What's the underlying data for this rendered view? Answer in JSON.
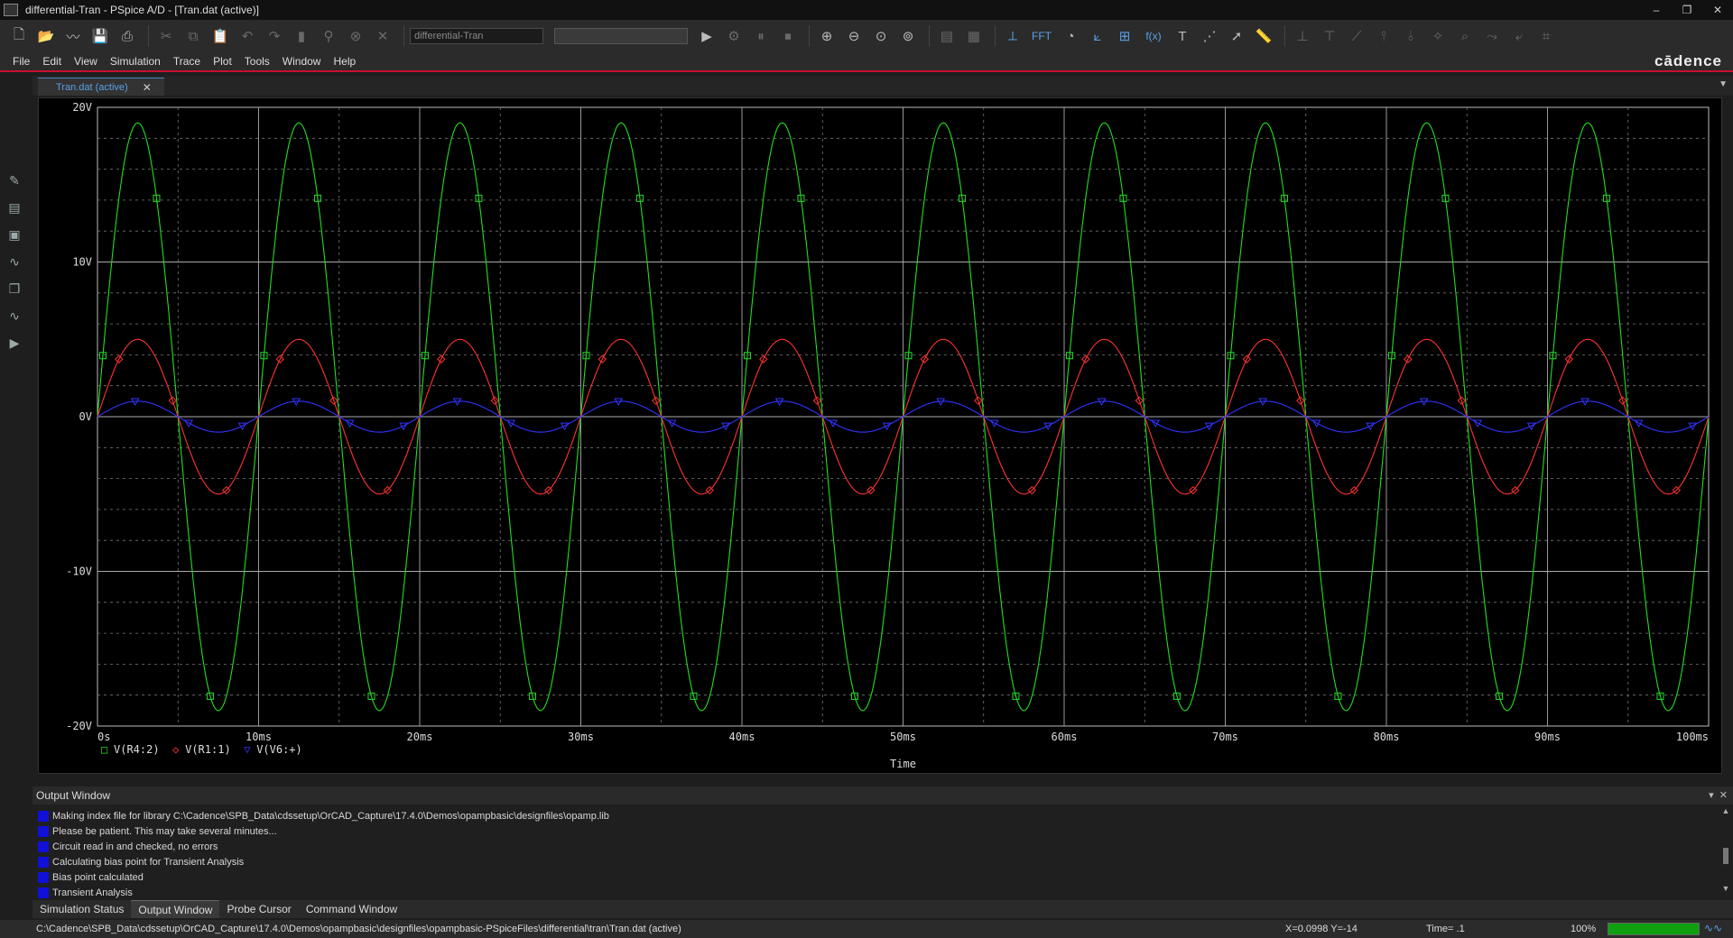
{
  "window": {
    "title": "differential-Tran - PSpice A/D  - [Tran.dat (active)]",
    "controls": [
      "–",
      "❐",
      "✕"
    ]
  },
  "toolbar": {
    "profile_value": "differential-Tran",
    "fft_label": "FFT",
    "fx_label": "f(x)"
  },
  "menu": [
    "File",
    "Edit",
    "View",
    "Simulation",
    "Trace",
    "Plot",
    "Tools",
    "Window",
    "Help"
  ],
  "brand": "cādence",
  "document_tab": {
    "label": "Tran.dat (active)",
    "close": "✕"
  },
  "plot": {
    "x_axis_title": "Time",
    "x_ticks": [
      "0s",
      "10ms",
      "20ms",
      "30ms",
      "40ms",
      "50ms",
      "60ms",
      "70ms",
      "80ms",
      "90ms",
      "100ms"
    ],
    "y_ticks": [
      "20V",
      "10V",
      "0V",
      "-10V",
      "-20V"
    ],
    "legend": [
      {
        "marker": "□",
        "name": "V(R4:2)",
        "color": "#22dd22"
      },
      {
        "marker": "◇",
        "name": "V(R1:1)",
        "color": "#ff3333"
      },
      {
        "marker": "▽",
        "name": "V(V6:+)",
        "color": "#3333ff"
      }
    ]
  },
  "chart_data": {
    "type": "line",
    "title": "",
    "xlabel": "Time",
    "ylabel": "",
    "xlim": [
      0,
      0.1
    ],
    "ylim": [
      -20,
      20
    ],
    "x_unit": "s",
    "y_unit": "V",
    "grid": true,
    "legend_position": "bottom-left",
    "series": [
      {
        "name": "V(R4:2)",
        "shape": "sine",
        "amplitude": 19,
        "frequency_hz": 100,
        "color": "#22dd22",
        "marker": "square"
      },
      {
        "name": "V(R1:1)",
        "shape": "sine",
        "amplitude": 5,
        "frequency_hz": 100,
        "color": "#ff3333",
        "marker": "diamond"
      },
      {
        "name": "V(V6:+)",
        "shape": "sine",
        "amplitude": 1,
        "frequency_hz": 100,
        "color": "#3333ff",
        "marker": "triangle-down"
      }
    ]
  },
  "output_window": {
    "title": "Output Window",
    "messages": [
      "Making index file for library C:\\Cadence\\SPB_Data\\cdssetup\\OrCAD_Capture\\17.4.0\\Demos\\opampbasic\\designfiles\\opamp.lib",
      "Please be patient. This may take several minutes...",
      "Circuit read in and checked, no errors",
      "Calculating bias point for Transient Analysis",
      "Bias point calculated",
      "Transient Analysis"
    ]
  },
  "bottom_tabs": [
    "Simulation Status",
    "Output Window",
    "Probe Cursor",
    "Command Window"
  ],
  "status": {
    "path": "C:\\Cadence\\SPB_Data\\cdssetup\\OrCAD_Capture\\17.4.0\\Demos\\opampbasic\\designfiles\\opampbasic-PSpiceFiles\\differential\\tran\\Tran.dat (active)",
    "coords": "X=0.0998  Y=-14",
    "time": "Time= .1",
    "zoom": "100%",
    "progress": 1.0
  }
}
